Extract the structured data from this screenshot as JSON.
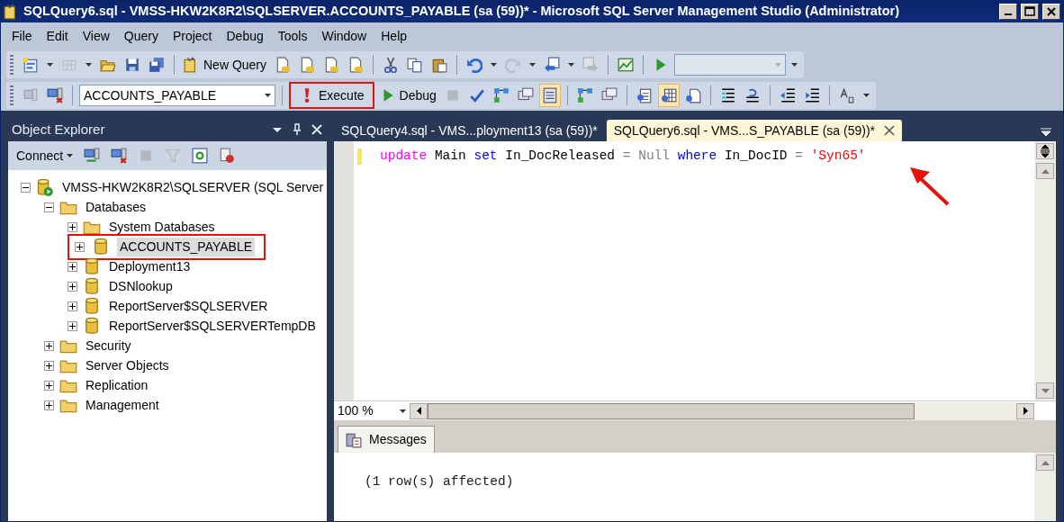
{
  "window": {
    "title": "SQLQuery6.sql - VMSS-HKW2K8R2\\SQLSERVER.ACCOUNTS_PAYABLE (sa (59))* - Microsoft SQL Server Management Studio (Administrator)"
  },
  "menu": [
    "File",
    "Edit",
    "View",
    "Query",
    "Project",
    "Debug",
    "Tools",
    "Window",
    "Help"
  ],
  "toolbar_1": {
    "new_query": "New Query",
    "undo_enabled": true,
    "redo_enabled": false
  },
  "toolbar_2": {
    "database": "ACCOUNTS_PAYABLE",
    "execute": {
      "label": "Execute",
      "highlighted": true
    },
    "debug": "Debug",
    "results_to_grid_pressed": true,
    "include_plan_pressed": true
  },
  "object_explorer": {
    "title": "Object Explorer",
    "connect": "Connect",
    "tree": [
      {
        "kind": "server",
        "label": "VMSS-HKW2K8R2\\SQLSERVER (SQL Server",
        "expanded": true,
        "selected": false,
        "highlighted": false,
        "children": [
          {
            "kind": "folder",
            "label": "Databases",
            "expanded": true,
            "selected": false,
            "highlighted": false,
            "children": [
              {
                "kind": "folder",
                "label": "System Databases",
                "expanded": false,
                "selected": false,
                "highlighted": false
              },
              {
                "kind": "database",
                "label": "ACCOUNTS_PAYABLE",
                "expanded": false,
                "selected": true,
                "highlighted": true
              },
              {
                "kind": "database",
                "label": "Deployment13",
                "expanded": false,
                "selected": false,
                "highlighted": false
              },
              {
                "kind": "database",
                "label": "DSNlookup",
                "expanded": false,
                "selected": false,
                "highlighted": false
              },
              {
                "kind": "database",
                "label": "ReportServer$SQLSERVER",
                "expanded": false,
                "selected": false,
                "highlighted": false
              },
              {
                "kind": "database",
                "label": "ReportServer$SQLSERVERTempDB",
                "expanded": false,
                "selected": false,
                "highlighted": false
              }
            ]
          },
          {
            "kind": "folder",
            "label": "Security",
            "expanded": false,
            "selected": false,
            "highlighted": false
          },
          {
            "kind": "folder",
            "label": "Server Objects",
            "expanded": false,
            "selected": false,
            "highlighted": false
          },
          {
            "kind": "folder",
            "label": "Replication",
            "expanded": false,
            "selected": false,
            "highlighted": false
          },
          {
            "kind": "folder",
            "label": "Management",
            "expanded": false,
            "selected": false,
            "highlighted": false
          }
        ]
      }
    ]
  },
  "editor_tabs": [
    {
      "label": "SQLQuery4.sql - VMS...ployment13 (sa (59))*",
      "selected": false
    },
    {
      "label": "SQLQuery6.sql - VMS...S_PAYABLE (sa (59))*",
      "selected": true
    }
  ],
  "code_line": [
    {
      "kind": "keyword2",
      "text": "update"
    },
    {
      "kind": "plain",
      "text": "Main"
    },
    {
      "kind": "keyword",
      "text": "set"
    },
    {
      "kind": "plain",
      "text": "In_DocReleased"
    },
    {
      "kind": "operator",
      "text": "="
    },
    {
      "kind": "operator",
      "text": "Null"
    },
    {
      "kind": "keyword",
      "text": "where"
    },
    {
      "kind": "plain",
      "text": "In_DocID"
    },
    {
      "kind": "operator",
      "text": "="
    },
    {
      "kind": "string",
      "text": "'Syn65'"
    }
  ],
  "zoom": "100 %",
  "results_tabs": [
    {
      "label": "Messages",
      "selected": true
    }
  ],
  "messages": [
    "(1 row(s) affected)"
  ]
}
